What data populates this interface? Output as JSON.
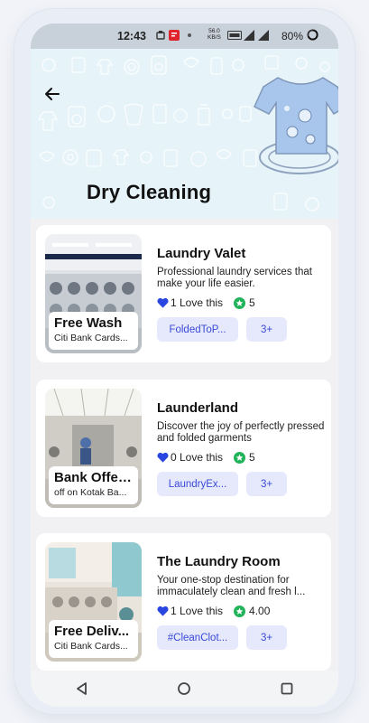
{
  "status_bar": {
    "time": "12:43",
    "battery": "80%",
    "network_speed": "56.0",
    "network_unit": "KB/S"
  },
  "header": {
    "title": "Dry Cleaning",
    "back_icon": "arrow-left-icon"
  },
  "listings": [
    {
      "name": "Laundry Valet",
      "description": "Professional laundry services that make your life easier.",
      "loves": "1 Love this",
      "rating": "5",
      "tag": "FoldedToP...",
      "more": "3+",
      "offer_title": "Free Wash",
      "offer_subtitle": "Citi Bank Cards..."
    },
    {
      "name": "Launderland",
      "description": "Discover the joy of perfectly pressed and folded garments",
      "loves": "0 Love this",
      "rating": "5",
      "tag": "LaundryEx...",
      "more": "3+",
      "offer_title": "Bank Offer...",
      "offer_subtitle": "off on Kotak Ba..."
    },
    {
      "name": "The Laundry Room",
      "description": "Your one-stop destination for immaculately clean and fresh l...",
      "loves": "1 Love this",
      "rating": "4.00",
      "tag": "#CleanClot...",
      "more": "3+",
      "offer_title": "Free Deliv...",
      "offer_subtitle": "Citi Bank Cards..."
    }
  ],
  "colors": {
    "accent": "#3b49d6",
    "chip_bg": "#e5e9fb",
    "heart": "#2a46e0",
    "star": "#21b35a",
    "header_bg": "#e6f3f9"
  },
  "navbar": {
    "back_icon": "triangle-back-icon",
    "home_icon": "circle-home-icon",
    "recents_icon": "square-recents-icon"
  }
}
